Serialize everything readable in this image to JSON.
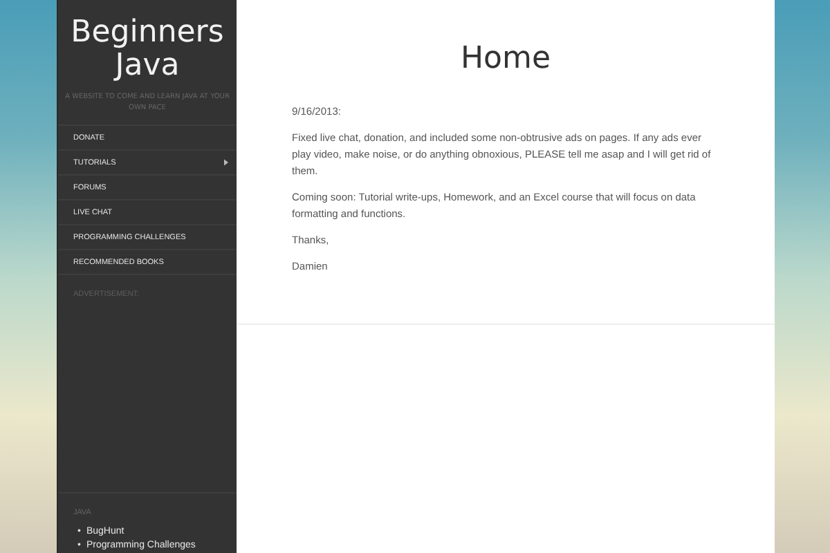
{
  "site": {
    "title": "Beginners Java",
    "tagline": "A WEBSITE TO COME AND LEARN JAVA AT YOUR OWN PACE"
  },
  "menu": [
    {
      "label": "DONATE",
      "has_submenu": false
    },
    {
      "label": "TUTORIALS",
      "has_submenu": true
    },
    {
      "label": "FORUMS",
      "has_submenu": false
    },
    {
      "label": "LIVE CHAT",
      "has_submenu": false
    },
    {
      "label": "PROGRAMMING CHALLENGES",
      "has_submenu": false
    },
    {
      "label": "RECOMMENDED BOOKS",
      "has_submenu": false
    }
  ],
  "advertisement": {
    "label": "ADVERTISEMENT:"
  },
  "widget": {
    "title": "JAVA",
    "links": [
      {
        "marker": "•",
        "label": "BugHunt"
      },
      {
        "marker": "•",
        "label": "Programming Challenges"
      }
    ]
  },
  "page": {
    "title": "Home",
    "paragraphs": [
      "9/16/2013:",
      "Fixed live chat, donation, and included some non-obtrusive ads on pages. If any ads ever play video, make noise, or do anything obnoxious, PLEASE tell me asap and I will get rid of them.",
      "Coming soon: Tutorial write-ups, Homework, and an Excel course that will focus on data formatting and functions.",
      "Thanks,",
      "Damien"
    ]
  }
}
